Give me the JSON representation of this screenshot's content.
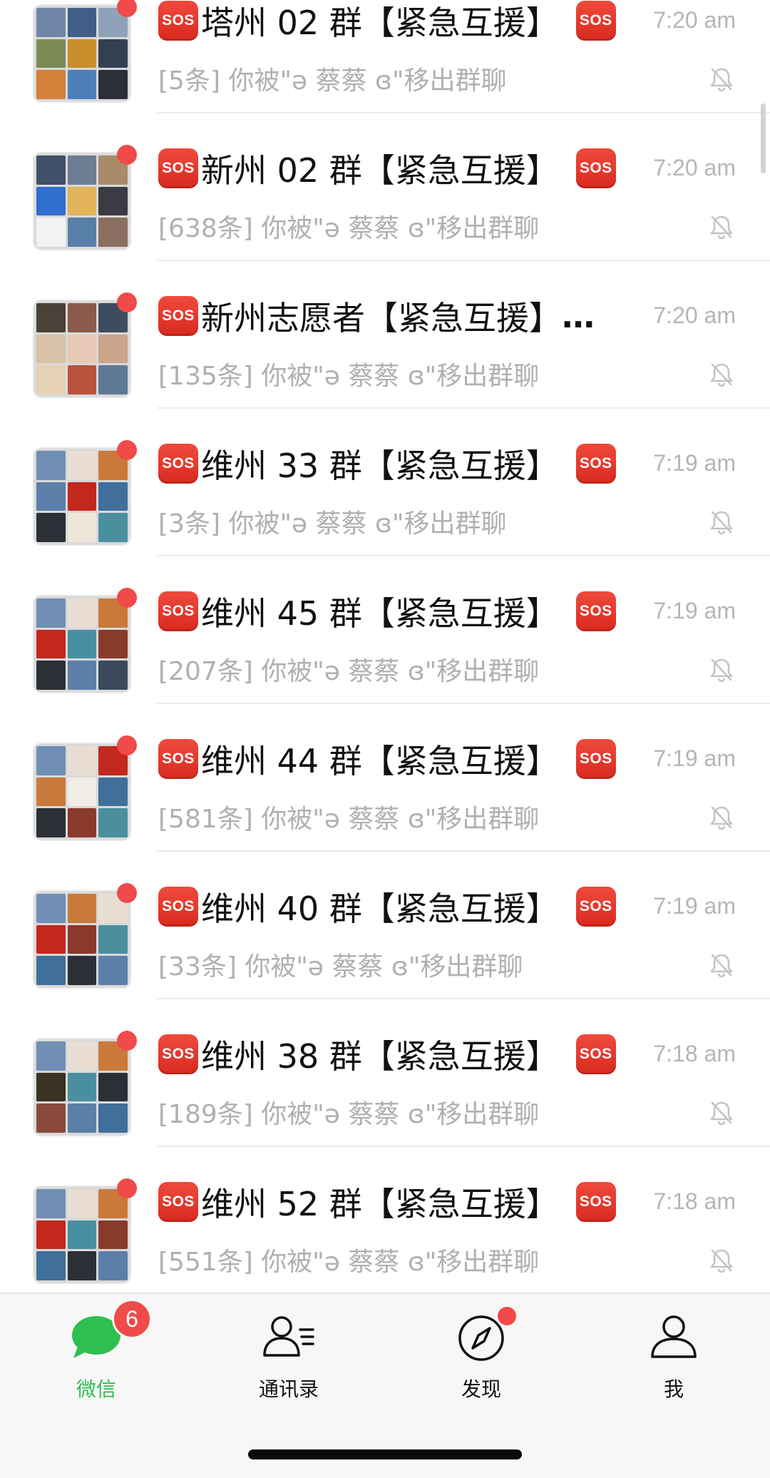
{
  "chats": [
    {
      "title": "塔州 02 群【紧急互援】",
      "trailing_sos": true,
      "time": "7:20 am",
      "preview": "[5条] 你被\"ə 蔡蔡 ɞ\"移出群聊",
      "muted": true,
      "unread_dot": true
    },
    {
      "title": "新州 02 群【紧急互援】",
      "trailing_sos": true,
      "time": "7:20 am",
      "preview": "[638条] 你被\"ə 蔡蔡 ɞ\"移出群聊",
      "muted": true,
      "unread_dot": true
    },
    {
      "title": "新州志愿者【紧急互援】",
      "trailing_sos": false,
      "truncated": "…",
      "time": "7:20 am",
      "preview": "[135条] 你被\"ə 蔡蔡 ɞ\"移出群聊",
      "muted": true,
      "unread_dot": true
    },
    {
      "title": "维州 33 群【紧急互援】",
      "trailing_sos": true,
      "time": "7:19 am",
      "preview": "[3条] 你被\"ə 蔡蔡 ɞ\"移出群聊",
      "muted": true,
      "unread_dot": true
    },
    {
      "title": "维州 45 群【紧急互援】",
      "trailing_sos": true,
      "time": "7:19 am",
      "preview": "[207条] 你被\"ə 蔡蔡 ɞ\"移出群聊",
      "muted": true,
      "unread_dot": true
    },
    {
      "title": "维州 44 群【紧急互援】",
      "trailing_sos": true,
      "time": "7:19 am",
      "preview": "[581条] 你被\"ə 蔡蔡 ɞ\"移出群聊",
      "muted": true,
      "unread_dot": true
    },
    {
      "title": "维州 40 群【紧急互援】",
      "trailing_sos": true,
      "time": "7:19 am",
      "preview": "[33条] 你被\"ə 蔡蔡 ɞ\"移出群聊",
      "muted": true,
      "unread_dot": true
    },
    {
      "title": "维州 38 群【紧急互援】",
      "trailing_sos": true,
      "time": "7:18 am",
      "preview": "[189条] 你被\"ə 蔡蔡 ɞ\"移出群聊",
      "muted": true,
      "unread_dot": true
    },
    {
      "title": "维州 52 群【紧急互援】",
      "trailing_sos": true,
      "time": "7:18 am",
      "preview": "[551条] 你被\"ə 蔡蔡 ɞ\"移出群聊",
      "muted": true,
      "unread_dot": true
    }
  ],
  "sos_label": "SOS",
  "tabbar": {
    "tabs": [
      {
        "label": "微信",
        "icon": "chat-bubble-icon",
        "active": true,
        "badge": "6"
      },
      {
        "label": "通讯录",
        "icon": "contacts-icon",
        "active": false
      },
      {
        "label": "发现",
        "icon": "compass-icon",
        "active": false,
        "dot": true
      },
      {
        "label": "我",
        "icon": "profile-icon",
        "active": false
      }
    ]
  },
  "colors": {
    "accent_green": "#2fbf4f",
    "badge_red": "#f04a4a",
    "sos_red": "#e0352a",
    "meta_gray": "#b0b0b0"
  }
}
